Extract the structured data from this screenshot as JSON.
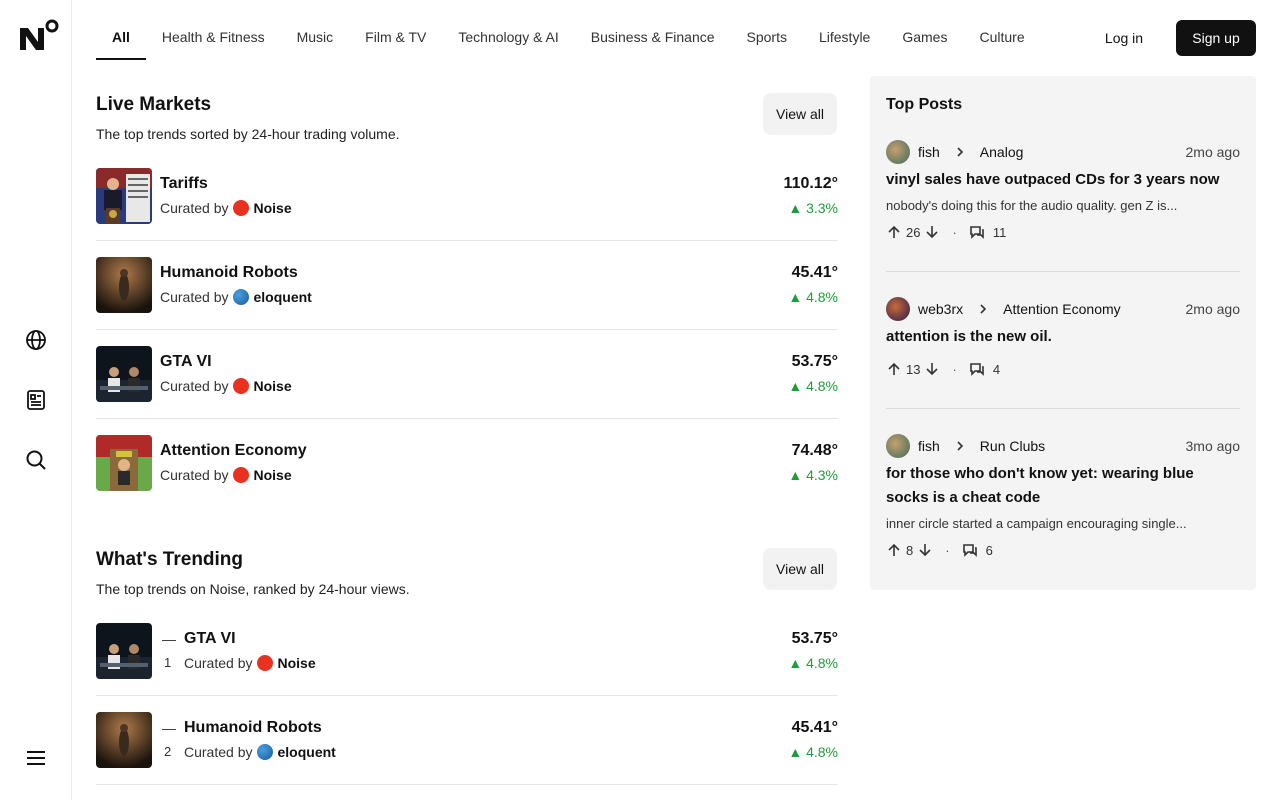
{
  "nav": {
    "tabs": [
      "All",
      "Health & Fitness",
      "Music",
      "Film & TV",
      "Technology & AI",
      "Business & Finance",
      "Sports",
      "Lifestyle",
      "Games",
      "Culture"
    ],
    "login": "Log in",
    "signup": "Sign up"
  },
  "live_markets": {
    "title": "Live Markets",
    "subtitle": "The top trends sorted by 24-hour trading volume.",
    "view_all": "View all",
    "rows": [
      {
        "title": "Tariffs",
        "curated_prefix": "Curated by",
        "curator": "Noise",
        "value": "110.12°",
        "change": "▲ 3.3%"
      },
      {
        "title": "Humanoid Robots",
        "curated_prefix": "Curated by",
        "curator": "eloquent",
        "value": "45.41°",
        "change": "▲ 4.8%"
      },
      {
        "title": "GTA VI",
        "curated_prefix": "Curated by",
        "curator": "Noise",
        "value": "53.75°",
        "change": "▲ 4.8%"
      },
      {
        "title": "Attention Economy",
        "curated_prefix": "Curated by",
        "curator": "Noise",
        "value": "74.48°",
        "change": "▲ 4.3%"
      }
    ]
  },
  "trending": {
    "title": "What's Trending",
    "subtitle": "The top trends on Noise, ranked by 24-hour views.",
    "view_all": "View all",
    "rows": [
      {
        "dash": "—",
        "rank": "1",
        "title": "GTA VI",
        "curated_prefix": "Curated by",
        "curator": "Noise",
        "value": "53.75°",
        "change": "▲ 4.8%"
      },
      {
        "dash": "—",
        "rank": "2",
        "title": "Humanoid Robots",
        "curated_prefix": "Curated by",
        "curator": "eloquent",
        "value": "45.41°",
        "change": "▲ 4.8%"
      }
    ]
  },
  "top_posts": {
    "title": "Top Posts",
    "posts": [
      {
        "author": "fish",
        "group": "Analog",
        "time": "2mo ago",
        "title": "vinyl sales have outpaced CDs for 3 years now",
        "body": "nobody's doing this for the audio quality. gen Z is...",
        "upvotes": "26",
        "comments": "11"
      },
      {
        "author": "web3rx",
        "group": "Attention Economy",
        "time": "2mo ago",
        "title": "attention is the new oil.",
        "body": "",
        "upvotes": "13",
        "comments": "4"
      },
      {
        "author": "fish",
        "group": "Run Clubs",
        "time": "3mo ago",
        "title": "for those who don't know yet: wearing blue socks is a cheat code",
        "body": "inner circle started a campaign encouraging single...",
        "upvotes": "8",
        "comments": "6"
      }
    ]
  },
  "colors": {
    "accent": "#111111",
    "positive": "#1f9d3a",
    "noise_brand": "#e8321f"
  },
  "icons": [
    "globe-icon",
    "document-icon",
    "search-icon",
    "menu-icon"
  ]
}
